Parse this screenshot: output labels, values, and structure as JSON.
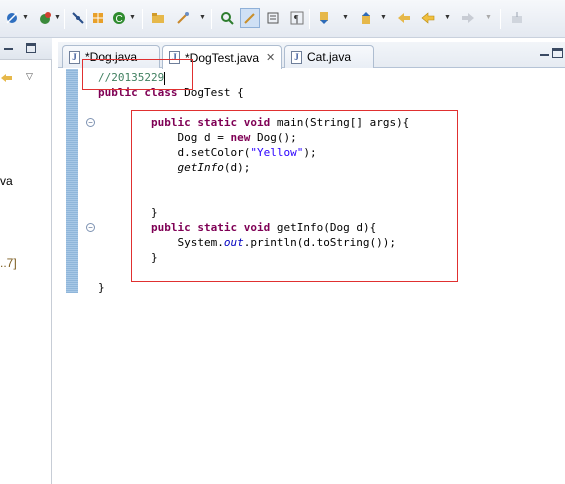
{
  "toolbar": {
    "icons": [
      "skip-breakpoints-icon",
      "open-type-icon",
      "run-icon",
      "new-class-icon",
      "open-folder-icon",
      "search-icon",
      "debug-step-icon",
      "mark-occurrences-icon",
      "toggle-block-icon",
      "show-whitespace-icon",
      "next-annotation-icon",
      "prev-annotation-icon",
      "last-edit-icon",
      "back-icon",
      "forward-icon",
      "pin-editor-icon"
    ]
  },
  "left_panel": {
    "fragments": [
      "va",
      "..7]"
    ]
  },
  "tabs": [
    {
      "label": "*Dog.java",
      "active": false
    },
    {
      "label": "*DogTest.java",
      "active": true
    },
    {
      "label": "Cat.java",
      "active": false
    }
  ],
  "code": {
    "comment": "//20135229",
    "class_kw1": "public",
    "class_kw2": "class",
    "class_rest": " DogTest {",
    "main_kw1": "public",
    "main_kw2": "static",
    "main_kw3": "void",
    "main_rest": " main(String[] args){",
    "line_dog_a": "Dog d = ",
    "line_dog_kw": "new",
    "line_dog_b": " Dog();",
    "line_color_a": "d.setColor(",
    "line_color_str": "\"Yellow\"",
    "line_color_b": ");",
    "line_getinfo_it": "getInfo",
    "line_getinfo_b": "(d);",
    "close1": "}",
    "getinfo_kw1": "public",
    "getinfo_kw2": "static",
    "getinfo_kw3": "void",
    "getinfo_rest": " getInfo(Dog d){",
    "println_a": "System.",
    "println_fld": "out",
    "println_b": ".println(d.toString());",
    "close2": "}",
    "close3": "}"
  },
  "colors": {
    "keyword": "#7f0055",
    "string": "#2a00ff",
    "comment": "#3f7f5f",
    "annotation_box": "#e03030"
  }
}
